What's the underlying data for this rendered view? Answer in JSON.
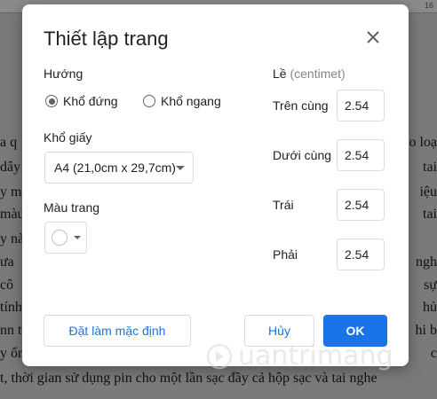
{
  "ruler": {
    "number": "16"
  },
  "background_doc": {
    "lines": [
      {
        "left": "a q",
        "right": "o loạ"
      },
      {
        "left": "dây",
        "right": "tai"
      },
      {
        "left": "y m",
        "right": "iệu"
      },
      {
        "left": "màu",
        "right": "tai"
      },
      {
        "left": "y nà",
        "right": ""
      },
      {
        "left": "ưa",
        "right": "ngh"
      },
      {
        "left": "cô",
        "right": "sự"
      },
      {
        "left": "tính",
        "right": "hủ"
      },
      {
        "left": "nn tớ",
        "right": "hi b"
      },
      {
        "left": "y ổn",
        "right": "c"
      },
      {
        "left": "t, thời gian sử dụng pin cho một lần sạc đầy cả hộp sạc và tai nghe",
        "right": ""
      }
    ]
  },
  "dialog": {
    "title": "Thiết lập trang",
    "close_icon": "close-icon",
    "orientation": {
      "label": "Hướng",
      "portrait_label": "Khổ đứng",
      "landscape_label": "Khổ ngang",
      "selected": "portrait"
    },
    "paper_size": {
      "label": "Khổ giấy",
      "value": "A4 (21,0cm x 29,7cm)"
    },
    "page_color": {
      "label": "Màu trang",
      "value": "#ffffff"
    },
    "margins": {
      "label": "Lề",
      "unit": "(centimet)",
      "top_label": "Trên cùng",
      "top_value": "2.54",
      "bottom_label": "Dưới cùng",
      "bottom_value": "2.54",
      "left_label": "Trái",
      "left_value": "2.54",
      "right_label": "Phải",
      "right_value": "2.54"
    },
    "buttons": {
      "set_default": "Đặt làm mặc định",
      "cancel": "Hủy",
      "ok": "OK"
    }
  },
  "watermark": {
    "text": "uantrimang",
    "icon": "quantrimang-logo-icon"
  },
  "colors": {
    "accent": "#1a73e8",
    "border": "#dadce0",
    "text": "#202124"
  }
}
